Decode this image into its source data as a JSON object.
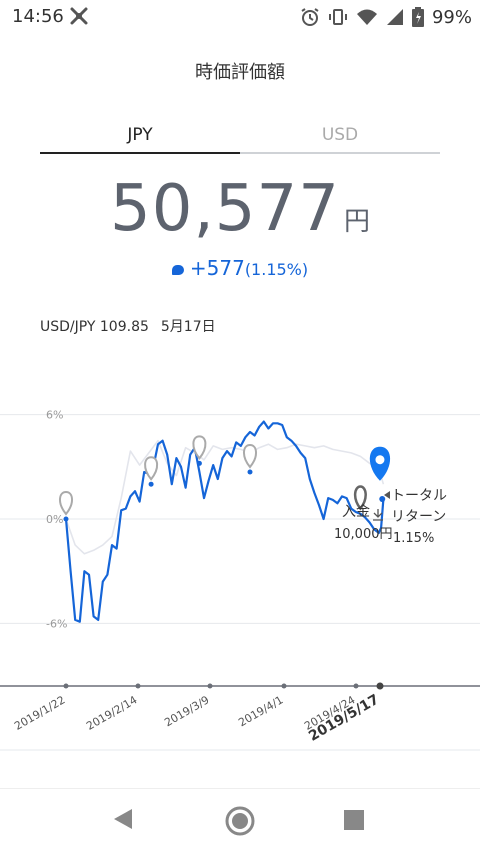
{
  "status": {
    "time": "14:56",
    "battery": "99%"
  },
  "header": {
    "title": "時価評価額"
  },
  "tabs": [
    {
      "label": "JPY"
    },
    {
      "label": "USD"
    }
  ],
  "summary": {
    "value": "50,577",
    "unit": "円",
    "change": "+577",
    "change_pct": "(1.15%)"
  },
  "fx": {
    "rate": "USD/JPY 109.85",
    "date": "5月17日"
  },
  "chart_data": {
    "type": "line",
    "y_ticks": [
      "6%",
      "0%",
      "-6%"
    ],
    "ylim": [
      -6,
      6
    ],
    "x_ticks": [
      "2019/1/22",
      "2019/2/14",
      "2019/3/9",
      "2019/4/1",
      "2019/4/24",
      "2019/5/17"
    ],
    "annotations": {
      "deposit_label": "入金",
      "deposit_amount": "10,000円",
      "return_label_1": "トータル",
      "return_label_2": "リターン",
      "return_value": "1.15%"
    },
    "series": [
      {
        "color": "#1565d8",
        "x_days": [
          0,
          2,
          4,
          6,
          8,
          10,
          12,
          14,
          16,
          18,
          20,
          22,
          24,
          26,
          28,
          30,
          32,
          34,
          36,
          38,
          40,
          42,
          44,
          46,
          48,
          50,
          52,
          54,
          56,
          58,
          60,
          62,
          64,
          66,
          68,
          70,
          72,
          74,
          76,
          78,
          80,
          82,
          84,
          86,
          88,
          90,
          92,
          94,
          96,
          98,
          100,
          102,
          104,
          106,
          108,
          110,
          112,
          114,
          116,
          118,
          120,
          122,
          124,
          126,
          128,
          130,
          132,
          134,
          136,
          137,
          138
        ],
        "values": [
          0,
          -3,
          -5.8,
          -5.9,
          -3,
          -3.2,
          -5.6,
          -5.8,
          -3.6,
          -3.2,
          -1.5,
          -1.7,
          0.5,
          0.6,
          1.3,
          1.6,
          1,
          2.7,
          2.6,
          3,
          4.3,
          4.5,
          3.7,
          2,
          3.5,
          3,
          1.8,
          3.7,
          4.1,
          2.7,
          1.2,
          2.2,
          3.1,
          2.3,
          3.5,
          3.9,
          3.6,
          4.4,
          4.2,
          4.7,
          5,
          4.8,
          5.3,
          5.6,
          5.2,
          5.5,
          5.5,
          5.4,
          4.7,
          4.5,
          4.2,
          3.8,
          3.5,
          2.3,
          1.5,
          0.8,
          0,
          1.2,
          1.1,
          0.9,
          1.3,
          1.2,
          0.6,
          0.4,
          0.3,
          0.1,
          -0.2,
          -0.6,
          -0.8,
          -0.5,
          1.15
        ]
      },
      {
        "color": "#e3e5ec",
        "x_days": [
          0,
          4,
          8,
          12,
          16,
          20,
          24,
          28,
          32,
          36,
          40,
          44,
          48,
          52,
          56,
          60,
          64,
          68,
          72,
          76,
          80,
          84,
          88,
          92,
          96,
          100,
          104,
          108,
          112,
          116,
          120,
          124,
          128,
          132,
          136,
          138
        ],
        "values": [
          0,
          -1.5,
          -2,
          -1.8,
          -1.5,
          -1,
          1.2,
          3.9,
          3.1,
          3.8,
          4.5,
          3.2,
          2.5,
          4.1,
          3.8,
          3.4,
          4.2,
          4,
          4.1,
          4,
          3.8,
          4.1,
          4.3,
          4,
          4.1,
          4.3,
          4.2,
          4.1,
          4.2,
          4,
          3.9,
          3.8,
          3.6,
          3.2,
          2.9,
          2
        ]
      }
    ],
    "markers": [
      {
        "day": 0,
        "value": 0
      },
      {
        "day": 37,
        "value": 2
      },
      {
        "day": 58,
        "value": 3.2
      },
      {
        "day": 80,
        "value": 2.7
      }
    ]
  }
}
